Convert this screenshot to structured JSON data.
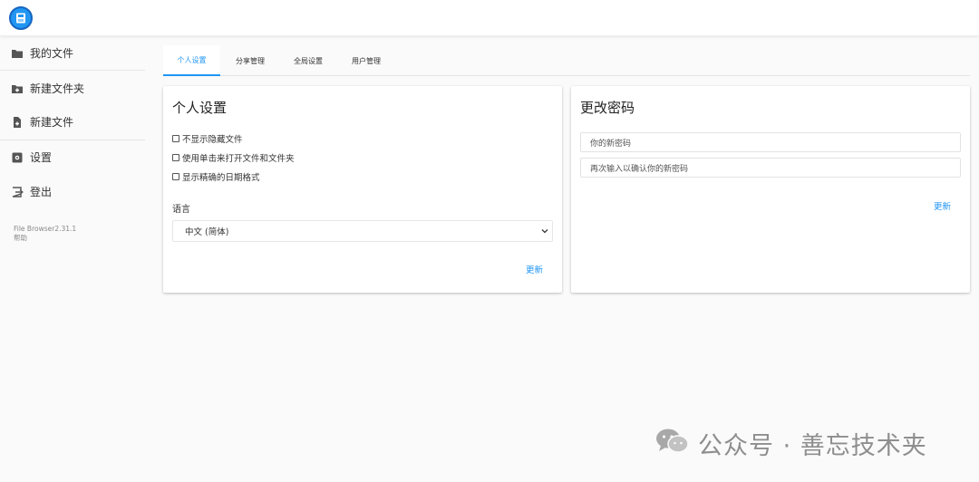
{
  "sidebar": {
    "items": [
      {
        "label": "我的文件",
        "icon": "folder-icon"
      },
      {
        "label": "新建文件夹",
        "icon": "new-folder-icon"
      },
      {
        "label": "新建文件",
        "icon": "new-file-icon"
      },
      {
        "label": "设置",
        "icon": "gear-icon"
      },
      {
        "label": "登出",
        "icon": "logout-icon"
      }
    ],
    "version": "File Browser2.31.1",
    "help": "帮助"
  },
  "tabs": [
    {
      "label": "个人设置",
      "active": true
    },
    {
      "label": "分享管理",
      "active": false
    },
    {
      "label": "全局设置",
      "active": false
    },
    {
      "label": "用户管理",
      "active": false
    }
  ],
  "profile": {
    "title": "个人设置",
    "checkboxes": [
      {
        "label": "不显示隐藏文件",
        "checked": false
      },
      {
        "label": "使用单击来打开文件和文件夹",
        "checked": false
      },
      {
        "label": "显示精确的日期格式",
        "checked": false
      }
    ],
    "language_label": "语言",
    "language_value": "中文 (简体)",
    "update_label": "更新"
  },
  "password": {
    "title": "更改密码",
    "new_placeholder": "你的新密码",
    "confirm_placeholder": "再次输入以确认你的新密码",
    "update_label": "更新"
  },
  "watermark": {
    "text": "公众号 · 善忘技术夹"
  },
  "colors": {
    "accent": "#2196f3",
    "background": "#fafafa",
    "card": "#ffffff"
  }
}
